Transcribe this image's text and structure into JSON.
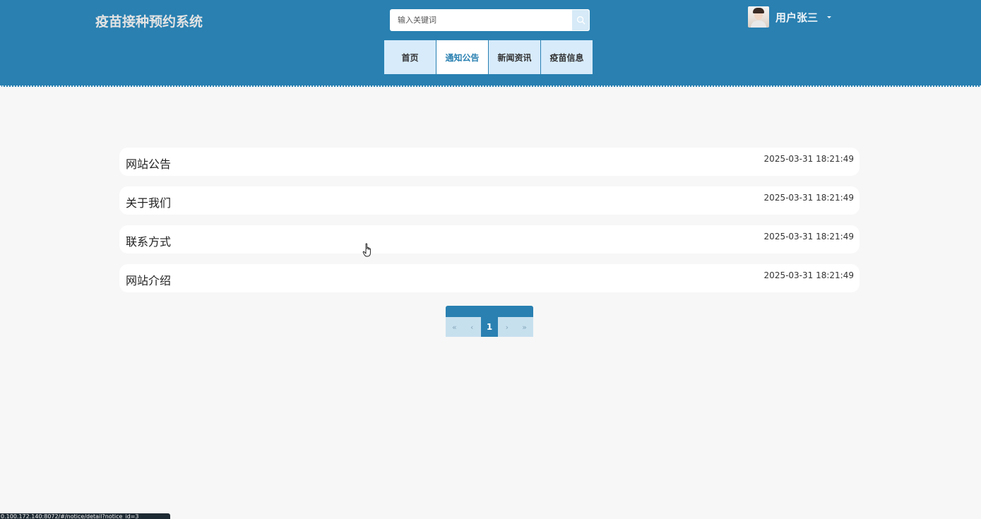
{
  "header": {
    "site_title": "疫苗接种预约系统",
    "search": {
      "placeholder": "输入关键词",
      "value": ""
    },
    "user": {
      "name": "用户张三"
    },
    "nav": [
      {
        "label": "首页"
      },
      {
        "label": "通知公告"
      },
      {
        "label": "新闻资讯"
      },
      {
        "label": "疫苗信息"
      }
    ],
    "active_nav": "通知公告"
  },
  "notices": [
    {
      "title": "网站公告",
      "time": "2025-03-31 18:21:49"
    },
    {
      "title": "关于我们",
      "time": "2025-03-31 18:21:49"
    },
    {
      "title": "联系方式",
      "time": "2025-03-31 18:21:49"
    },
    {
      "title": "网站介绍",
      "time": "2025-03-31 18:21:49"
    }
  ],
  "pagination": {
    "first": "«",
    "prev": "‹",
    "current": "1",
    "next": "›",
    "last": "»"
  },
  "status_url": "0.100.172.140:8072/#/notice/detail?notice_id=3",
  "colors": {
    "header_bg": "#2980b1",
    "nav_bg": "#d7ebfb",
    "nav_active_text": "#2980b1",
    "page_bg": "#f7f7f7"
  },
  "icons": {
    "search": "search-icon",
    "dropdown": "caret-down-icon",
    "cursor": "hand-pointer-icon"
  }
}
